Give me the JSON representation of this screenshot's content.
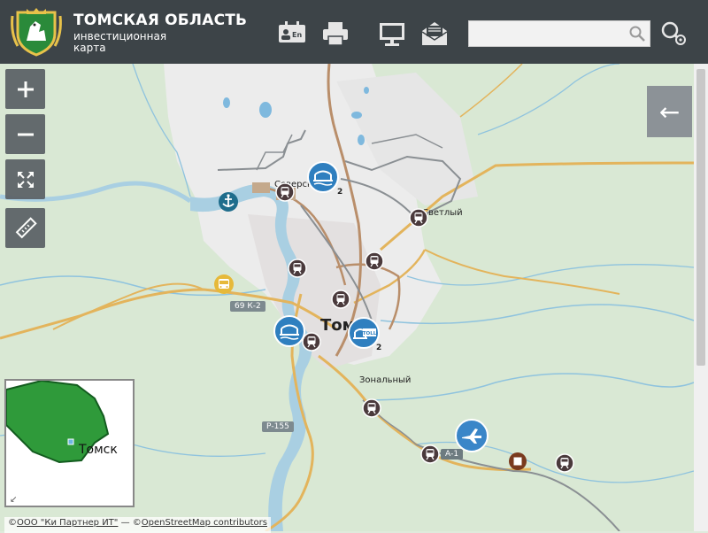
{
  "header": {
    "title": "ТОМСКАЯ ОБЛАСТЬ",
    "subtitle": "инвестиционная карта",
    "icons": [
      "language-en-icon",
      "print-icon",
      "presentation-icon",
      "email-icon"
    ],
    "search_placeholder": "",
    "colors": {
      "bar": "#3d4448",
      "accent": "#2f7fbf"
    }
  },
  "controls": {
    "zoom_in": "+",
    "zoom_out": "−",
    "panel_arrow": "←"
  },
  "map_labels": {
    "seversk": "Северск",
    "svetly": "Светлый",
    "tomsk": "Томск",
    "zonalny": "Зональный",
    "road_69k2": "69 К-2",
    "road_p155": "Р-155",
    "road_a1": "А-1",
    "bridge_num_1": "2",
    "bridge_num_2": "2",
    "toll": "TOLL"
  },
  "minimap": {
    "label": "Томск"
  },
  "attribution": {
    "prefix": "©",
    "partner": "ООО \"Ки Партнер ИТ\"",
    "sep": " — ©",
    "osm": "OpenStreetMap contributors"
  }
}
